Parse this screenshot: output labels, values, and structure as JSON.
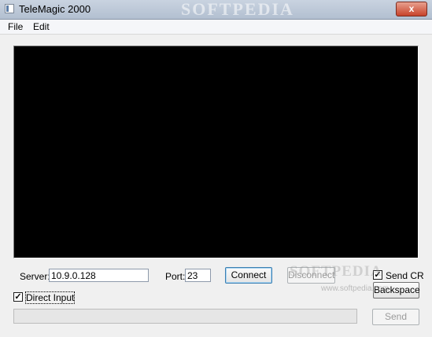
{
  "window": {
    "title": "TeleMagic 2000",
    "close_label": "x",
    "watermark": "SOFTPEDIA"
  },
  "menu": {
    "items": [
      "File",
      "Edit"
    ]
  },
  "connection": {
    "server_label": "Server:",
    "server_value": "10.9.0.128",
    "port_label": "Port:",
    "port_value": "23",
    "connect_label": "Connect",
    "disconnect_label": "Disconnect",
    "send_cr_label": "Send CR",
    "send_cr_checked": true,
    "backspace_label": "Backspace"
  },
  "input_area": {
    "direct_input_label": "Direct Input",
    "direct_input_checked": true,
    "send_label": "Send",
    "progress": 0
  },
  "watermark": {
    "big": "SOFTPEDIA",
    "small": "www.softpedia.com"
  },
  "icons": {
    "app": "app-icon",
    "check": "check-icon"
  }
}
